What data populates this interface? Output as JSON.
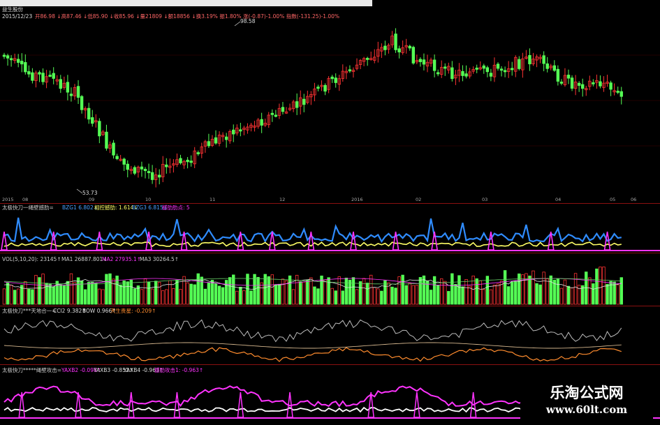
{
  "stock": {
    "name": "益生股份",
    "date": "2015/12/23",
    "quote": "开86.98 ↓高87.46 ↓低85.90 ↓收85.96 ↓量21809 ↓额18856 ↓换3.19% 振1.80% 涨(-0.87)-1.00% 指数(-131.25)-1.00%",
    "high_mark": "98.58",
    "low_mark": "53.73",
    "axis_labels": [
      "2015",
      "08",
      "09",
      "10",
      "11",
      "12",
      "2016",
      "02",
      "03",
      "04",
      "05",
      "06"
    ]
  },
  "panel1": {
    "title": "太极快刀一绳壁撼肋=",
    "v1": "BZG1 6.802↓",
    "v2": "相控撼肋: 1.614↓",
    "v3": "BZG3 6.815↓",
    "v4": "撼肋肋点: 5"
  },
  "vol": {
    "title": "VOL(5,10,20): 23145↑",
    "ma1": "MA1 26887.801↓",
    "ma2": "MA2 27935.1↑",
    "ma3": "MA3 30264.5↑"
  },
  "panel3": {
    "title": "太极快刀***天地合一=",
    "v1": "CCI2 9.382↑",
    "v2": "BOW 0.966↑",
    "v3": "天生贵星: -0.209↑"
  },
  "panel4": {
    "title": "太极快刀*****绳壁攻击=",
    "v1": "YAXB2 -0.098↑",
    "v2": "YAXB3 -0.852↑",
    "v3": "YAXB4 -0.963↑",
    "v4": "撼肋攻击1: -0.963↑"
  },
  "brand": {
    "cn": "乐淘公式网",
    "url": "www.60lt.com"
  },
  "colors": {
    "up": "#ff3333",
    "down": "#55ff55",
    "blue": "#2f8cff",
    "yellow": "#ffff66",
    "magenta": "#ff33ff",
    "orange": "#ff8c2e",
    "grid": "#8a1010"
  }
}
